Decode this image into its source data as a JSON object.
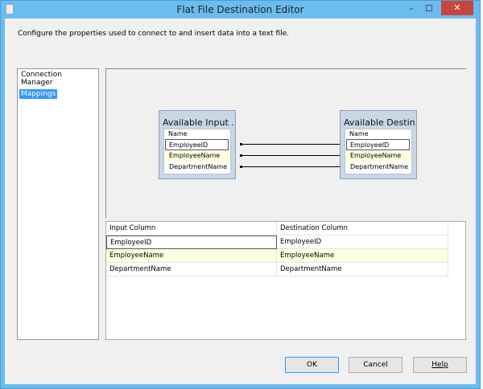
{
  "window": {
    "title": "Flat File Destination Editor",
    "minimize": "–",
    "maximize": "☐",
    "close": "✕"
  },
  "description": "Configure the properties used to connect to and insert data into a text file.",
  "nav": {
    "items": [
      {
        "label": "Connection Manager"
      },
      {
        "label": "Mappings"
      }
    ]
  },
  "diagram": {
    "input_box": {
      "title": "Available Input ...",
      "header": "Name",
      "columns": [
        "EmployeeID",
        "EmployeeName",
        "DepartmentName"
      ]
    },
    "dest_box": {
      "title": "Available Destin...",
      "header": "Name",
      "columns": [
        "EmployeeID",
        "EmployeeName",
        "DepartmentName"
      ]
    }
  },
  "grid": {
    "headers": [
      "Input Column",
      "Destination Column"
    ],
    "rows": [
      [
        "EmployeeID",
        "EmployeeID"
      ],
      [
        "EmployeeName",
        "EmployeeName"
      ],
      [
        "DepartmentName",
        "DepartmentName"
      ]
    ]
  },
  "buttons": {
    "ok": "OK",
    "cancel": "Cancel",
    "help": "Help"
  }
}
